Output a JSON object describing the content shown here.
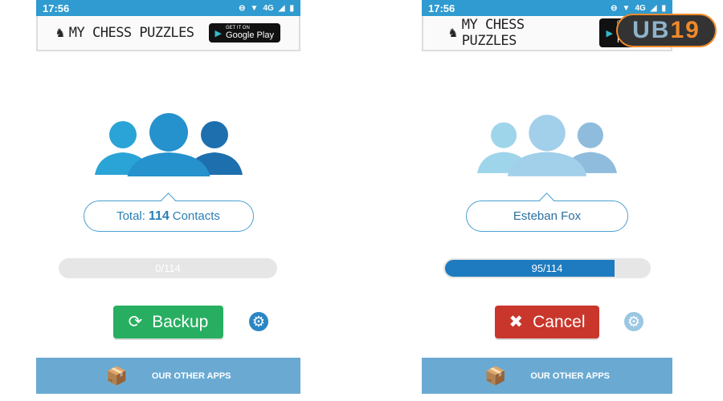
{
  "status": {
    "time": "17:56",
    "network": "4G"
  },
  "ad": {
    "brand": "MY CHESS PUZZLES",
    "store_small": "GET IT ON",
    "store": "Google Play"
  },
  "left": {
    "total_prefix": "Total:",
    "total_count": "114",
    "total_suffix": "Contacts",
    "progress_text": "0/114",
    "progress": 0,
    "button": "Backup",
    "other_apps": "OUR OTHER APPS"
  },
  "right": {
    "contact_name": "Esteban Fox",
    "progress_text": "95/114",
    "progress": 0.833,
    "button": "Cancel",
    "other_apps": "OUR OTHER APPS"
  },
  "watermark": {
    "text_a": "UB",
    "text_b": "19"
  },
  "colors": {
    "status": "#2f9bd0",
    "backup": "#27ae60",
    "cancel": "#c9362b",
    "progress": "#1e7bbf",
    "apps_bar": "#6aaad2"
  }
}
